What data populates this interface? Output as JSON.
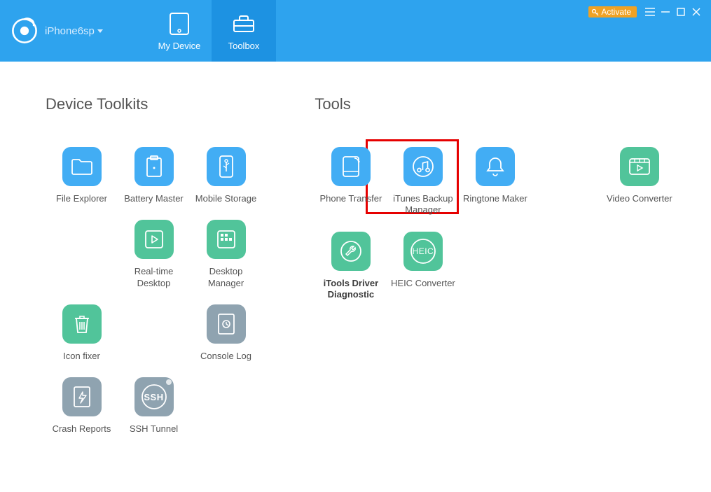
{
  "header": {
    "device_name": "iPhone6sp",
    "activate_label": "Activate",
    "tabs": {
      "my_device": "My Device",
      "toolbox": "Toolbox"
    }
  },
  "sections": {
    "device_toolkits_title": "Device Toolkits",
    "tools_title": "Tools"
  },
  "device_toolkits": {
    "file_explorer": "File Explorer",
    "battery_master": "Battery Master",
    "mobile_storage": "Mobile Storage",
    "realtime_desktop": "Real-time Desktop",
    "desktop_manager": "Desktop Manager",
    "icon_fixer": "Icon fixer",
    "console_log": "Console Log",
    "crash_reports": "Crash Reports",
    "ssh_tunnel": "SSH Tunnel",
    "ssh_tunnel_icon_text": "SSH"
  },
  "tools": {
    "phone_transfer": "Phone Transfer",
    "itunes_backup_manager": "iTunes Backup Manager",
    "ringtone_maker": "Ringtone Maker",
    "video_converter": "Video Converter",
    "itools_driver_diagnostic": "iTools Driver Diagnostic",
    "heic_converter": "HEIC Converter",
    "heic_icon_text": "HEIC"
  }
}
